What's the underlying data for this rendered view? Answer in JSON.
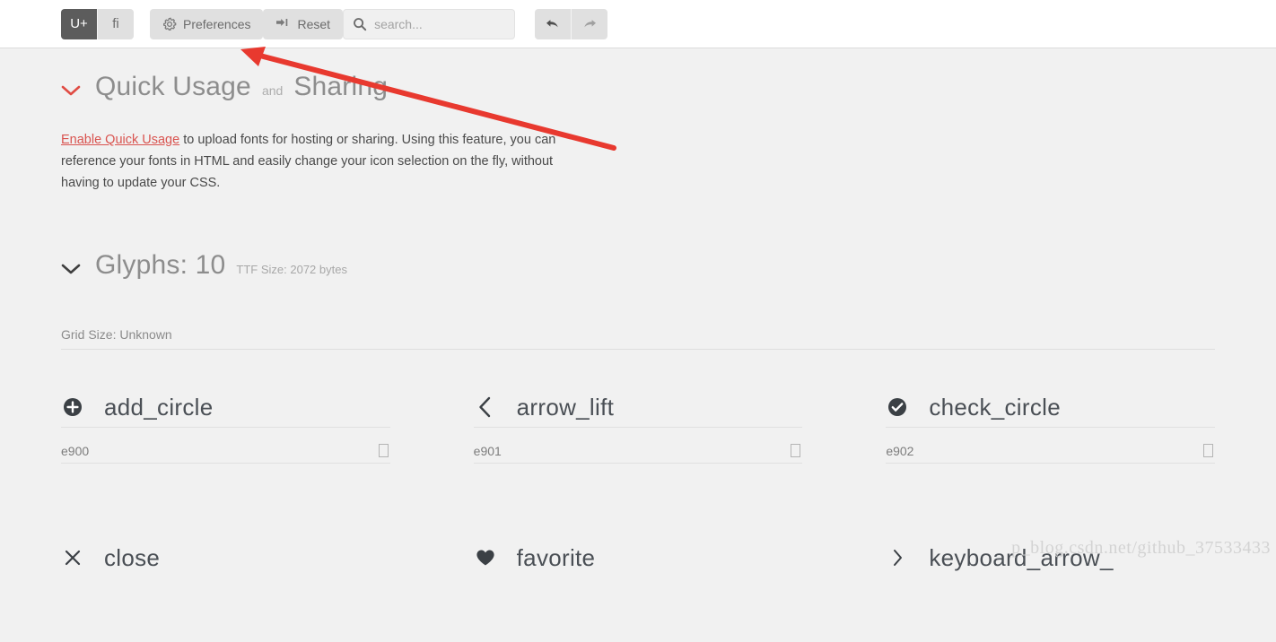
{
  "toolbar": {
    "unicode_toggle": {
      "label": "U+",
      "icon": "unicode-icon",
      "active": true
    },
    "ligature_toggle": {
      "label": "fi",
      "icon": "ligature-icon",
      "active": false
    },
    "preferences": {
      "label": "Preferences",
      "icon": "gear-icon"
    },
    "reset": {
      "label": "Reset",
      "icon": "tab-reset-icon"
    },
    "search": {
      "placeholder": "search...",
      "value": "",
      "icon": "search-icon"
    },
    "undo": {
      "label": "",
      "icon": "undo-arrow-icon",
      "active": true
    },
    "redo": {
      "label": "",
      "icon": "redo-arrow-icon",
      "active": false
    }
  },
  "quick_usage": {
    "chevron": "❯",
    "title": "Quick Usage",
    "title_conjunction": "and",
    "title_second": "Sharing",
    "link_text": "Enable Quick Usage",
    "body_text": " to upload fonts for hosting or sharing. Using this feature, you can reference your fonts in HTML and easily change your icon selection on the fly, without having to update your CSS."
  },
  "glyphs_section": {
    "chevron": "❯",
    "title": "Glyphs: 10",
    "meta": "TTF Size: 2072 bytes",
    "grid_size": "Grid Size: Unknown",
    "items": [
      {
        "icon": "add-circle-icon",
        "name": "add_circle",
        "code": "e900"
      },
      {
        "icon": "arrow-left-chevron-icon",
        "name": "arrow_lift",
        "code": "e901"
      },
      {
        "icon": "check-circle-icon",
        "name": "check_circle",
        "code": "e902"
      },
      {
        "icon": "close-x-icon",
        "name": "close",
        "code": ""
      },
      {
        "icon": "heart-favorite-icon",
        "name": "favorite",
        "code": ""
      },
      {
        "icon": "keyboard-arrow-right-icon",
        "name": "keyboard_arrow_",
        "code": ""
      }
    ]
  },
  "annotation": {
    "color": "#e8392f"
  },
  "watermark": {
    "text": "p_blog.csdn.net/github_37533433"
  },
  "colors": {
    "page_background": "#f1f1f1",
    "toolbar_background": "#ffffff",
    "accent_red": "#d9534f",
    "button_grey": "#e0e0e0",
    "button_active": "#5c5c5c"
  }
}
